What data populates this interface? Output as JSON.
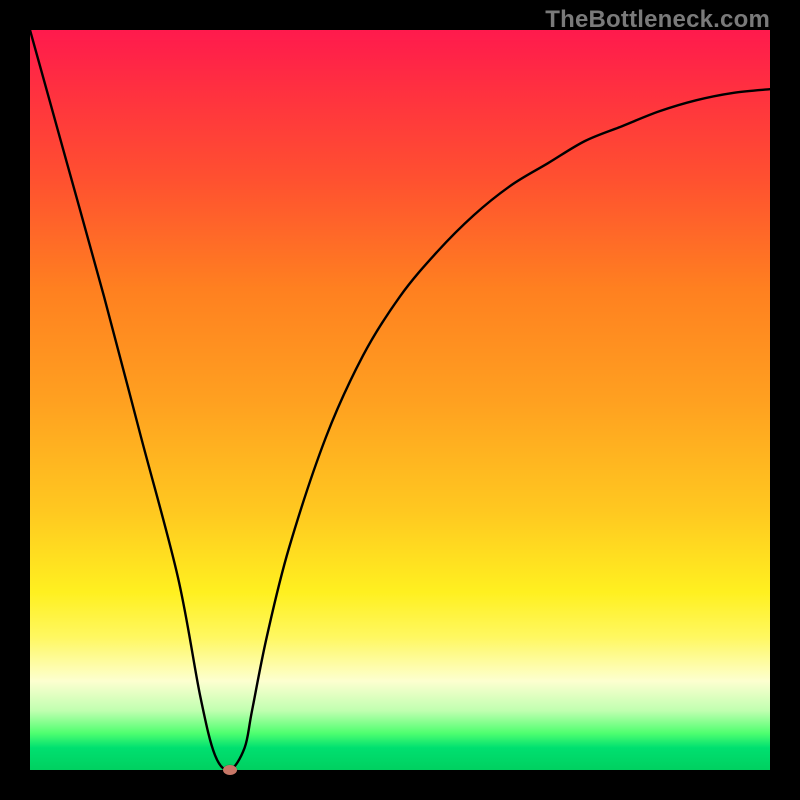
{
  "watermark": "TheBottleneck.com",
  "chart_data": {
    "type": "line",
    "title": "",
    "xlabel": "",
    "ylabel": "",
    "xlim": [
      0,
      100
    ],
    "ylim": [
      0,
      100
    ],
    "series": [
      {
        "name": "bottleneck-curve",
        "x": [
          0,
          5,
          10,
          15,
          20,
          23,
          25,
          27,
          29,
          30,
          32,
          35,
          40,
          45,
          50,
          55,
          60,
          65,
          70,
          75,
          80,
          85,
          90,
          95,
          100
        ],
        "values": [
          100,
          82,
          64,
          45,
          26,
          10,
          2,
          0,
          3,
          8,
          18,
          30,
          45,
          56,
          64,
          70,
          75,
          79,
          82,
          85,
          87,
          89,
          90.5,
          91.5,
          92
        ],
        "color": "#000000"
      }
    ],
    "background_gradient": {
      "top_color": "#ff1a4d",
      "mid_color": "#ffc820",
      "bottom_color": "#00d060"
    },
    "marker": {
      "name": "minimum-point",
      "x": 27,
      "y": 0,
      "color": "#c77767"
    }
  }
}
